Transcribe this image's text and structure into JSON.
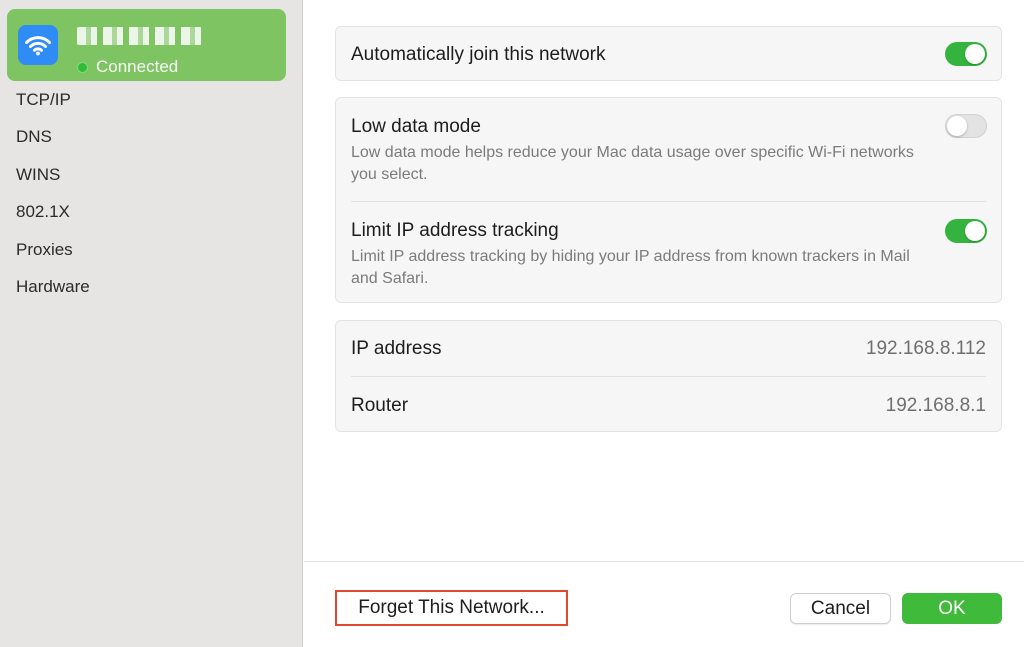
{
  "colors": {
    "sidebar_bg": "#e6e5e4",
    "network_card_bg": "#7ec463",
    "wifi_tile": "#2f8cf5",
    "toggle_on": "#34b43f",
    "ok_button": "#3fba3a",
    "highlight_border": "#e2482f"
  },
  "sidebar": {
    "network": {
      "icon": "wifi-icon",
      "name": "",
      "status": "Connected"
    },
    "items": [
      {
        "label": "TCP/IP"
      },
      {
        "label": "DNS"
      },
      {
        "label": "WINS"
      },
      {
        "label": "802.1X"
      },
      {
        "label": "Proxies"
      },
      {
        "label": "Hardware"
      }
    ]
  },
  "settings": {
    "auto_join": {
      "title": "Automatically join this network",
      "enabled": true
    },
    "low_data": {
      "title": "Low data mode",
      "description": "Low data mode helps reduce your Mac data usage over specific Wi-Fi networks you select.",
      "enabled": false
    },
    "limit_ip": {
      "title": "Limit IP address tracking",
      "description": "Limit IP address tracking by hiding your IP address from known trackers in Mail and Safari.",
      "enabled": true
    },
    "ip_address": {
      "label": "IP address",
      "value": "192.168.8.112"
    },
    "router": {
      "label": "Router",
      "value": "192.168.8.1"
    }
  },
  "footer": {
    "forget_label": "Forget This Network...",
    "cancel_label": "Cancel",
    "ok_label": "OK"
  }
}
